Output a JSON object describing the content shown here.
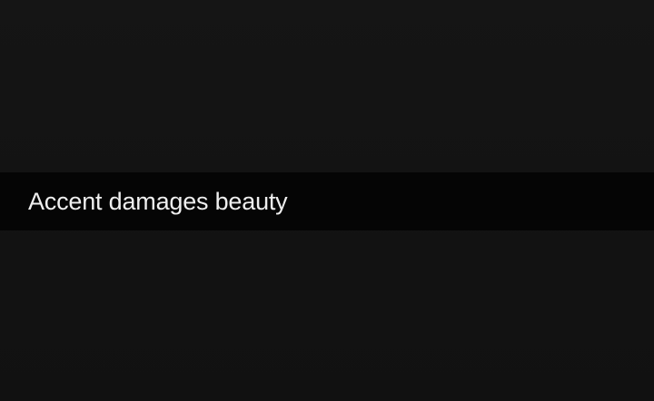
{
  "banner": {
    "text": "Accent damages beauty"
  },
  "colors": {
    "background": "#131313",
    "banner_background": "#050505",
    "text": "#efefef"
  }
}
